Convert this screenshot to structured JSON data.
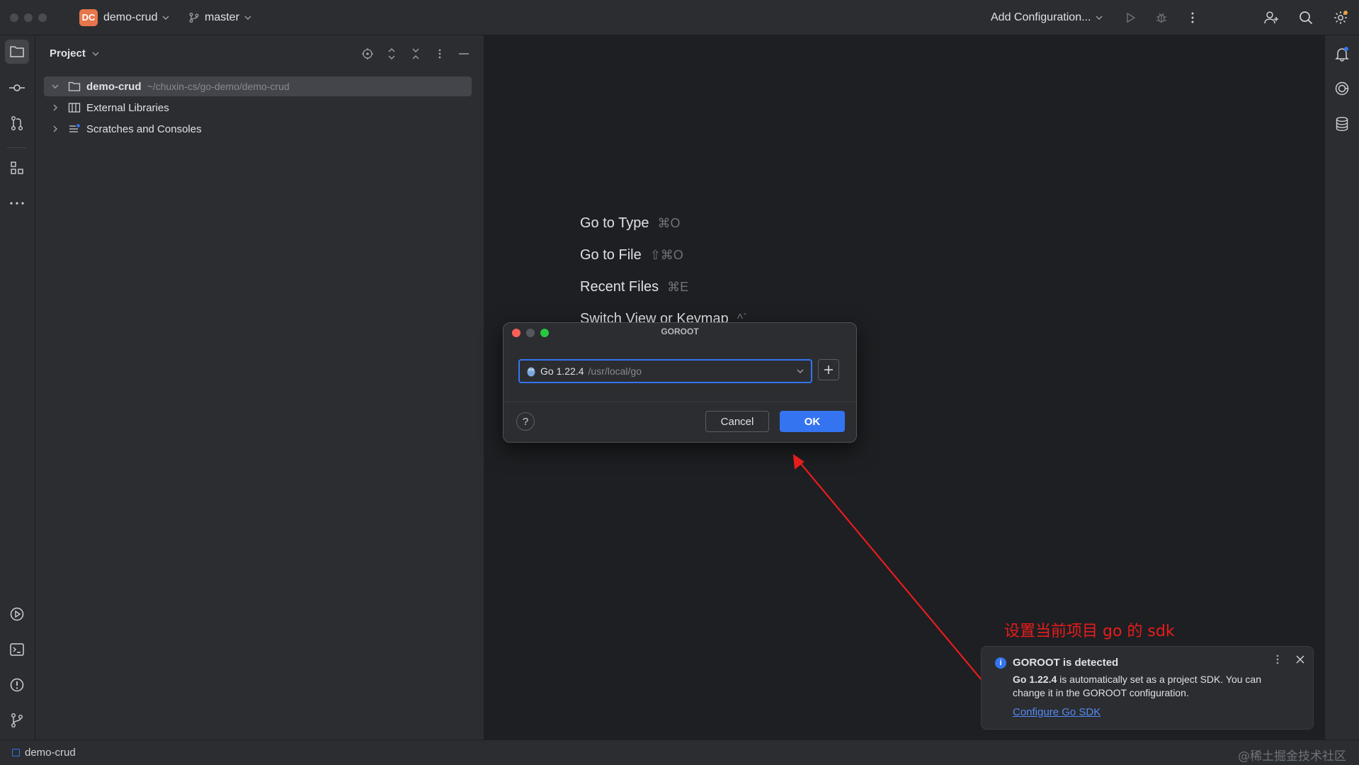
{
  "titlebar": {
    "project_badge": "DC",
    "project_name": "demo-crud",
    "branch": "master",
    "run_config": "Add Configuration..."
  },
  "project_panel": {
    "title": "Project",
    "tree": [
      {
        "label": "demo-crud",
        "path": "~/chuxin-cs/go-demo/demo-crud",
        "icon": "folder-icon",
        "selected": true
      },
      {
        "label": "External Libraries",
        "icon": "library-icon"
      },
      {
        "label": "Scratches and Consoles",
        "icon": "scratches-icon"
      }
    ]
  },
  "editor": {
    "hints": [
      {
        "label": "Go to Type",
        "shortcut": "⌘O"
      },
      {
        "label": "Go to File",
        "shortcut": "⇧⌘O"
      },
      {
        "label": "Recent Files",
        "shortcut": "⌘E"
      },
      {
        "label": "Switch View or Keymap",
        "shortcut": "^`"
      }
    ]
  },
  "dialog": {
    "title": "GOROOT",
    "sdk_name": "Go 1.22.4",
    "sdk_path": "/usr/local/go",
    "help": "?",
    "cancel": "Cancel",
    "ok": "OK"
  },
  "annotation": {
    "text": "设置当前项目 go 的 sdk",
    "color": "#e81c1c"
  },
  "notification": {
    "title": "GOROOT is detected",
    "body_bold": "Go 1.22.4",
    "body_rest": " is automatically set as a project SDK. You can change it in the GOROOT configuration.",
    "link": "Configure Go SDK"
  },
  "statusbar": {
    "project": "demo-crud",
    "watermark": "@稀土掘金技术社区"
  },
  "colors": {
    "accent": "#3574f0",
    "background": "#1e1f22",
    "panel": "#2b2d30",
    "project_badge": "#e6764b"
  }
}
